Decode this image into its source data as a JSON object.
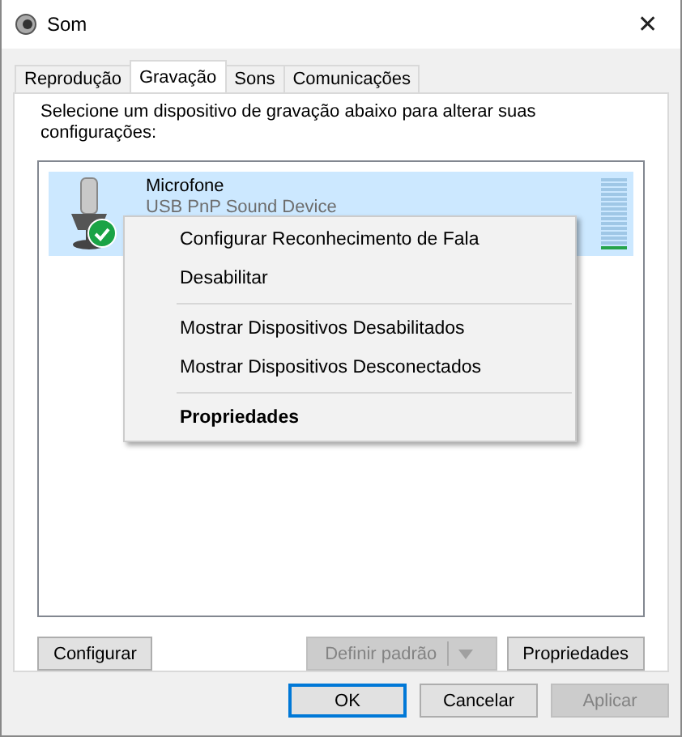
{
  "window": {
    "title": "Som",
    "close": "✕"
  },
  "tabs": [
    {
      "label": "Reprodução",
      "selected": false
    },
    {
      "label": "Gravação",
      "selected": true
    },
    {
      "label": "Sons",
      "selected": false
    },
    {
      "label": "Comunicações",
      "selected": false
    }
  ],
  "instruction": "Selecione um dispositivo de gravação abaixo para alterar suas configurações:",
  "devices": [
    {
      "name": "Microfone",
      "description": "USB PnP Sound Device",
      "selected": true,
      "default": true,
      "level": 0.06
    }
  ],
  "context_menu": [
    {
      "kind": "item",
      "label": "Configurar Reconhecimento de Fala",
      "bold": false
    },
    {
      "kind": "item",
      "label": "Desabilitar",
      "bold": false
    },
    {
      "kind": "separator"
    },
    {
      "kind": "item",
      "label": "Mostrar Dispositivos Desabilitados",
      "bold": false
    },
    {
      "kind": "item",
      "label": "Mostrar Dispositivos Desconectados",
      "bold": false
    },
    {
      "kind": "separator"
    },
    {
      "kind": "item",
      "label": "Propriedades",
      "bold": true
    }
  ],
  "device_buttons": [
    {
      "kind": "button",
      "label": "Configurar",
      "disabled": false
    },
    {
      "kind": "split",
      "label": "Definir padrão",
      "disabled": true
    },
    {
      "kind": "button",
      "label": "Propriedades",
      "disabled": false
    }
  ],
  "dialog_buttons": [
    {
      "label": "OK",
      "disabled": false,
      "default": true
    },
    {
      "label": "Cancelar",
      "disabled": false,
      "default": false
    },
    {
      "label": "Aplicar",
      "disabled": true,
      "default": false
    }
  ]
}
